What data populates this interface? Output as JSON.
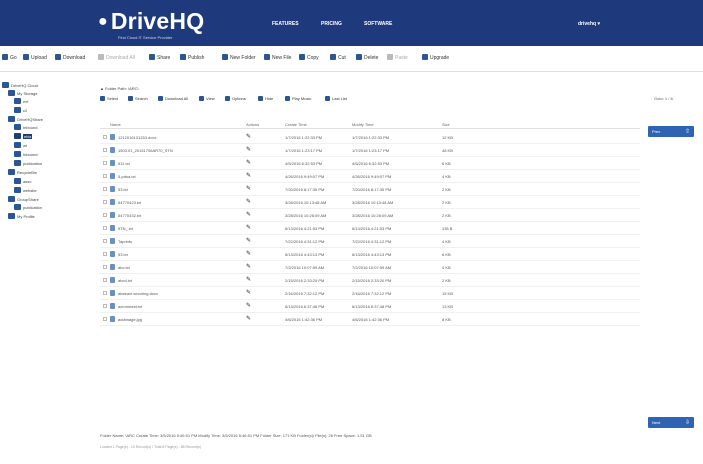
{
  "header": {
    "logo": "DriveHQ",
    "logo_subtitle": "First Cloud IT Service Provider",
    "nav": [
      "FEATURES",
      "PRICING",
      "SOFTWARE"
    ],
    "user": "drivehq"
  },
  "toolbar": {
    "items": [
      "Go",
      "Upload",
      "Download",
      "Download All",
      "Share",
      "Publish",
      "New Folder",
      "New File",
      "Copy",
      "Cut",
      "Delete",
      "Paste",
      "Upgrade"
    ]
  },
  "tree": {
    "items": [
      {
        "label": "DriveHQ Cloud"
      },
      {
        "label": "My Storage"
      },
      {
        "label": "ext"
      },
      {
        "label": "c2"
      },
      {
        "label": "DriveHQShare"
      },
      {
        "label": "Inbound"
      },
      {
        "label": "ebiz"
      },
      {
        "label": "wt"
      },
      {
        "label": "Inbound"
      },
      {
        "label": "publication"
      },
      {
        "label": "RecycleBin"
      },
      {
        "label": "asso"
      },
      {
        "label": "website"
      },
      {
        "label": "GroupShare"
      },
      {
        "label": "publication"
      },
      {
        "label": "My Profile"
      }
    ]
  },
  "main": {
    "folder_path": "Folder Path: \\ARC\\",
    "actions": [
      "Select",
      "Search",
      "Download All",
      "View",
      "Options",
      "Hide",
      "Play Music",
      "Last List"
    ],
    "goto_label": "Goto: 1 / 8",
    "prev_label": "Prev",
    "next_label": "Next"
  },
  "table": {
    "columns": [
      "Name",
      "Actions",
      "Create Time",
      "Modify Time",
      "Size"
    ],
    "rows": [
      {
        "name": "1212016131253.docx",
        "create": "1/7/2016 1:22:33 PM",
        "modify": "1/7/2016 1:22:33 PM",
        "size": "12 KB"
      },
      {
        "name": "1503.01_20151706AR70_STN",
        "create": "1/7/2016 1:23:17 PM",
        "modify": "1/7/2016 1:23:17 PM",
        "size": "48 KB"
      },
      {
        "name": "511.txt",
        "create": "4/5/2016 6:32:53 PM",
        "modify": "4/5/2016 6:32:53 PM",
        "size": "6 KB"
      },
      {
        "name": "5-pdsa.txt",
        "create": "4/26/2016 9:49:07 PM",
        "modify": "4/26/2016 9:49:07 PM",
        "size": "4 KB"
      },
      {
        "name": "53.txt",
        "create": "7/20/2016 8:17:35 PM",
        "modify": "7/20/2016 8:17:35 PM",
        "size": "2 KB"
      },
      {
        "name": "54770423.txt",
        "create": "3/28/2016 10:13:48 AM",
        "modify": "3/28/2016 10:13:48 AM",
        "size": "2 KB"
      },
      {
        "name": "54770432.txt",
        "create": "3/28/2016 10:26:09 AM",
        "modify": "3/28/2016 10:26:09 AM",
        "size": "2 KB"
      },
      {
        "name": "5TN_.txt",
        "create": "6/13/2016 4:21:53 PM",
        "modify": "6/13/2016 4:21:53 PM",
        "size": "136 B"
      },
      {
        "name": "Taprinfo",
        "create": "7/22/2016 4:31:12 PM",
        "modify": "7/22/2016 4:31:12 PM",
        "size": "4 KB"
      },
      {
        "name": "53.txt",
        "create": "6/13/2016 4:43:13 PM",
        "modify": "6/13/2016 4:43:13 PM",
        "size": "6 KB"
      },
      {
        "name": "abc.txt",
        "create": "7/2/2016 10:07:59 AM",
        "modify": "7/2/2016 10:07:59 AM",
        "size": "4 KB"
      },
      {
        "name": "abcd.txt",
        "create": "2/15/2016 2:33:20 PM",
        "modify": "2/15/2016 2:33:20 PM",
        "size": "2 KB"
      },
      {
        "name": "abstract securing.docx",
        "create": "2/16/2016 7:32:12 PM",
        "modify": "2/16/2016 7:32:12 PM",
        "size": "15 KB"
      },
      {
        "name": "acronmeet.txt",
        "create": "6/13/2016 6:37:48 PM",
        "modify": "6/13/2016 6:37:48 PM",
        "size": "13 KB"
      },
      {
        "name": "addimage.jpg",
        "create": "4/6/2016 1:42:36 PM",
        "modify": "4/6/2016 1:42:36 PM",
        "size": "8 KB"
      }
    ]
  },
  "footer": {
    "line1": "Folder Name: \\ARC    Create Time: 3/5/2016 5:46:51 PM    Modify Time: 3/5/2016 5:46:51 PM    Folder Size: 171 KB    Folder(s)/ File(s): 26    Free Space: 1.51 GB",
    "line2": "Loaded 1 Page(s) - 15 Record(s) / Total 8 Page(s) - 88 Record(s)"
  },
  "colors": {
    "header_bg": "#1e3a7c",
    "accent": "#2f64b5"
  }
}
